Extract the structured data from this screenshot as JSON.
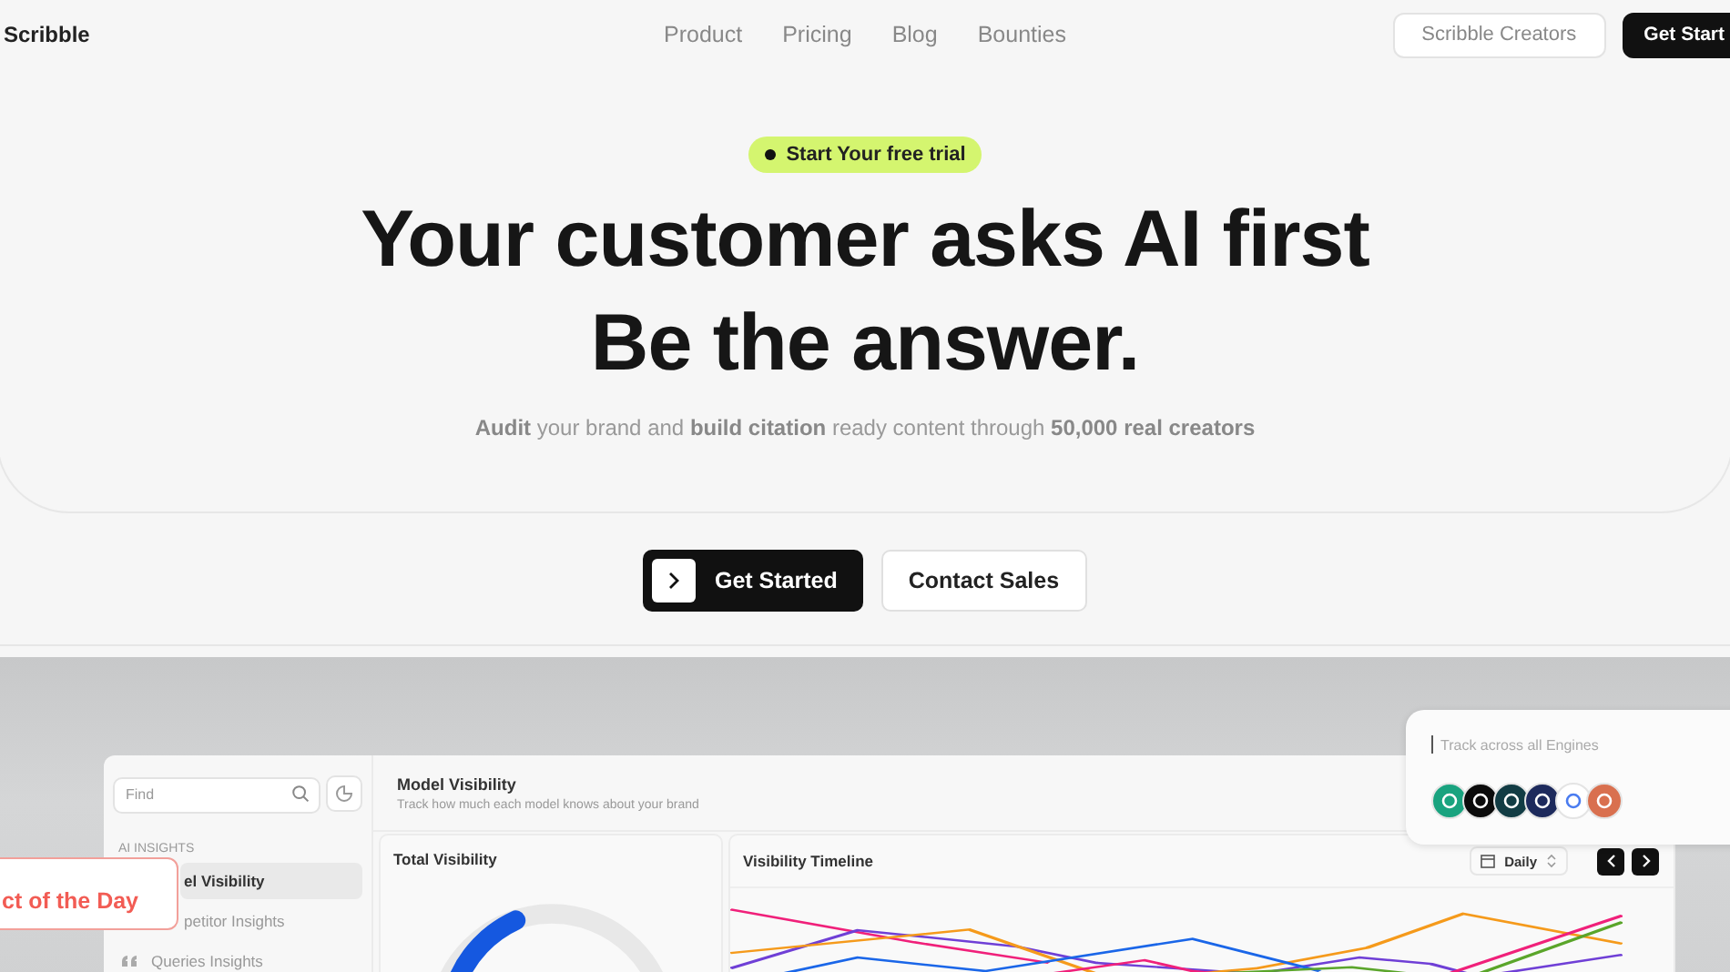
{
  "nav": {
    "logo": "Scribble",
    "links": [
      "Product",
      "Pricing",
      "Blog",
      "Bounties"
    ],
    "secondary_button": "Scribble Creators",
    "primary_button": "Get Start"
  },
  "hero": {
    "badge": "Start Your free trial",
    "title_lines": [
      "Your customer asks AI first",
      "Be the answer."
    ],
    "subtitle": "**Audit** your brand and **build citation** ready content through **50,000 real creators**"
  },
  "cta": {
    "primary": "Get Started",
    "secondary": "Contact Sales"
  },
  "dashboard": {
    "search": {
      "placeholder": "Find"
    },
    "section_label": "AI INSIGHTS",
    "nav_items": [
      {
        "label": "el Visibility",
        "selected": true,
        "icon": false
      },
      {
        "label": "petitor Insights",
        "selected": false,
        "icon": false
      },
      {
        "label": "Queries Insights",
        "selected": false,
        "icon": true
      }
    ],
    "header": {
      "title": "Model Visibility",
      "subtitle": "Track how much each model knows about your brand"
    },
    "cards": [
      {
        "title": "Total Visibility",
        "kind": "donut"
      },
      {
        "title": "Visibility Timeline",
        "kind": "timeline",
        "period": "Daily"
      }
    ]
  },
  "engines_popup": {
    "placeholder": "Track across all Engines",
    "engines": [
      {
        "color": "#19a37f"
      },
      {
        "color": "#0b0b0b"
      },
      {
        "color": "#123c44"
      },
      {
        "color": "#1d2a5c"
      },
      {
        "color": "#ffffff"
      },
      {
        "color": "#d9704f"
      }
    ]
  },
  "award_badge": {
    "text": "ct of the Day"
  }
}
